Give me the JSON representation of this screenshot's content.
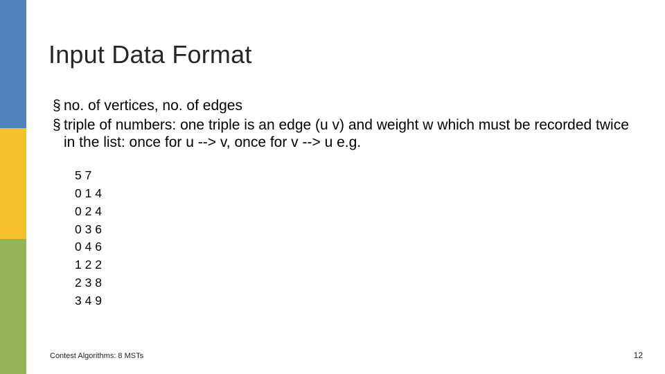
{
  "title": "Input Data Format",
  "bullets": [
    "no. of vertices, no. of edges",
    "triple of numbers: one triple is an edge (u v) and weight w which must be recorded twice in the list: once for u --> v, once for v --> u  e.g."
  ],
  "data_lines": [
    "5 7",
    "0 1 4",
    "0 2 4",
    "0 3 6",
    "0 4 6",
    "1 2 2",
    "2 3 8",
    "3 4 9"
  ],
  "footer_left": "Contest Algorithms: 8 MSTs",
  "footer_right": "12"
}
